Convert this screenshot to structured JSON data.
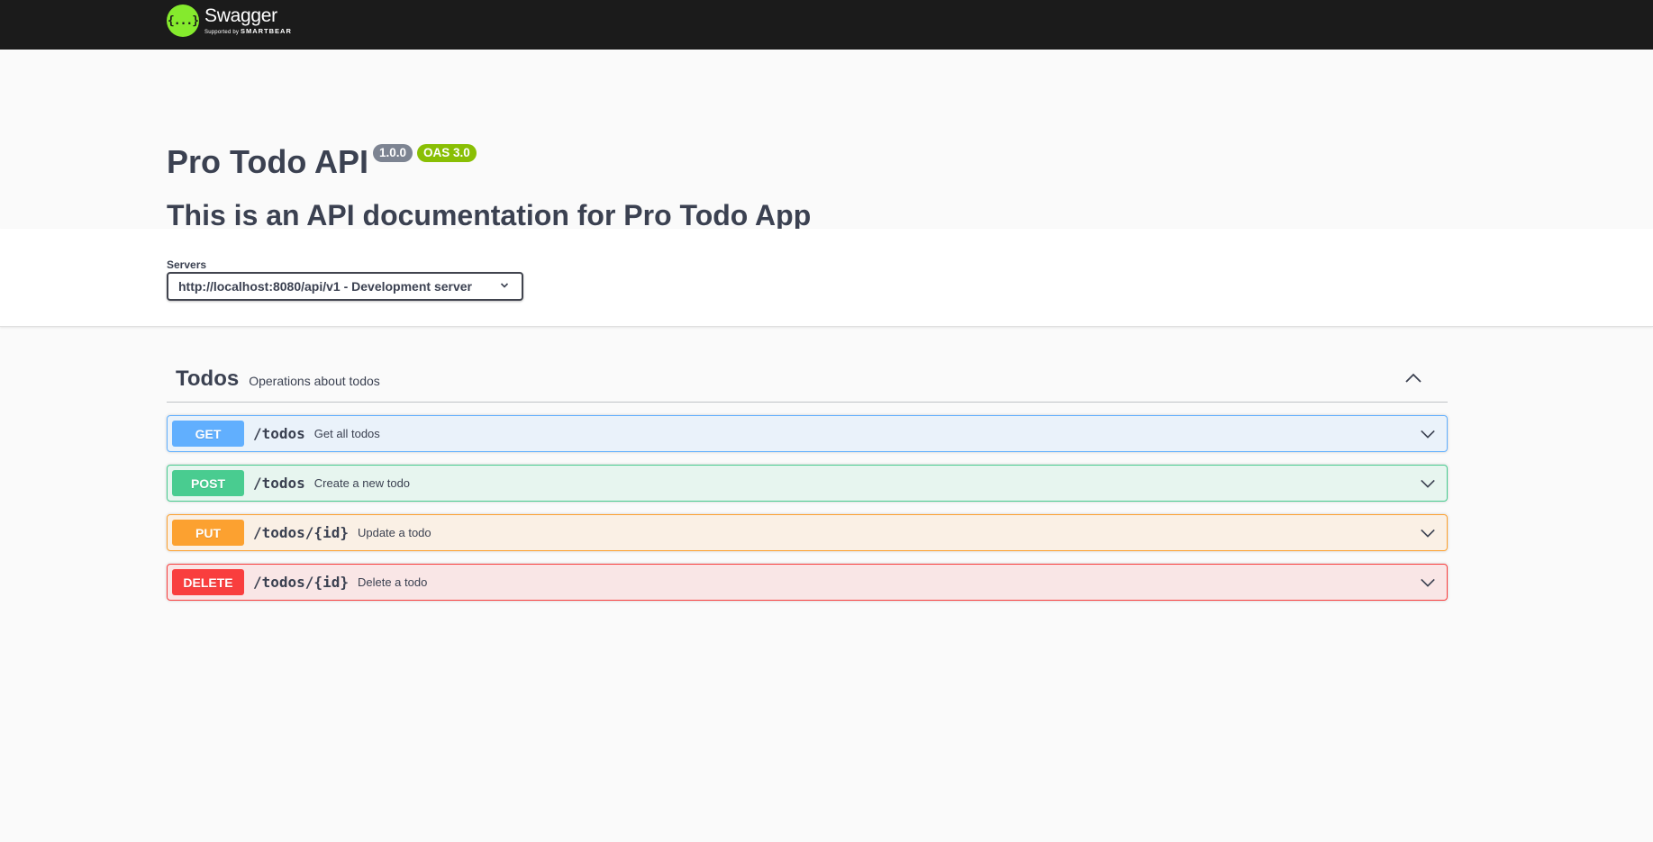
{
  "header": {
    "brand_name": "Swagger",
    "brand_sub_prefix": "Supported by",
    "brand_sub_company": "SMARTBEAR",
    "logo_glyph": "{...}",
    "logo_color": "#85ea2d"
  },
  "info": {
    "title": "Pro Todo API",
    "version_badge": "1.0.0",
    "oas_badge": "OAS 3.0",
    "description": "This is an API documentation for Pro Todo App"
  },
  "servers": {
    "label": "Servers",
    "selected": "http://localhost:8080/api/v1 - Development server"
  },
  "tag": {
    "name": "Todos",
    "description": "Operations about todos",
    "expanded": true,
    "operations": [
      {
        "method": "GET",
        "path": "/todos",
        "summary": "Get all todos",
        "color": "#61affe"
      },
      {
        "method": "POST",
        "path": "/todos",
        "summary": "Create a new todo",
        "color": "#49cc90"
      },
      {
        "method": "PUT",
        "path": "/todos/{id}",
        "summary": "Update a todo",
        "color": "#fca130"
      },
      {
        "method": "DELETE",
        "path": "/todos/{id}",
        "summary": "Delete a todo",
        "color": "#f93e3e"
      }
    ]
  }
}
